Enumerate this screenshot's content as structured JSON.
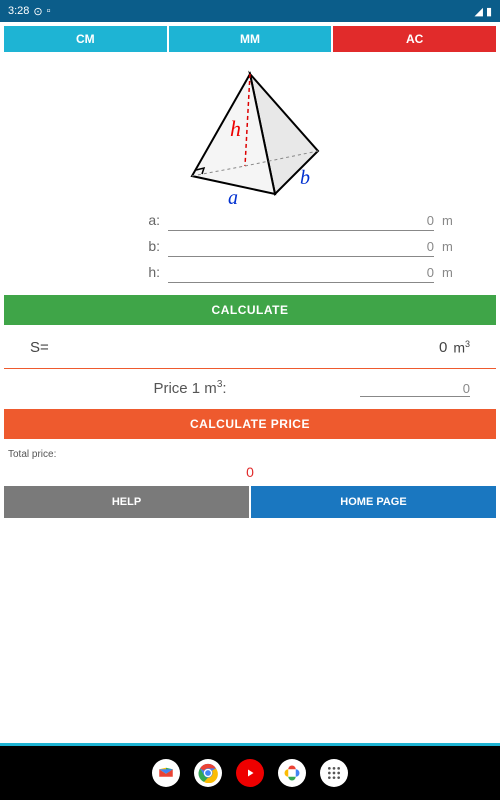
{
  "status": {
    "time": "3:28",
    "signal": "◢",
    "battery": "▮"
  },
  "tabs": {
    "cm": "CM",
    "mm": "MM",
    "ac": "AC"
  },
  "diagram": {
    "label_h": "h",
    "label_a": "a",
    "label_b": "b"
  },
  "inputs": {
    "a": {
      "label": "a:",
      "value": "0",
      "unit": "m"
    },
    "b": {
      "label": "b:",
      "value": "0",
      "unit": "m"
    },
    "h": {
      "label": "h:",
      "value": "0",
      "unit": "m"
    }
  },
  "buttons": {
    "calculate": "CALCULATE",
    "calculate_price": "CALCULATE PRICE",
    "help": "HELP",
    "home": "HOME PAGE"
  },
  "result": {
    "label": "S=",
    "value": "0",
    "unit_base": "m",
    "unit_exp": "3"
  },
  "price": {
    "label_prefix": "Price 1 m",
    "label_exp": "3",
    "label_suffix": ":",
    "value": "0"
  },
  "total": {
    "label": "Total price:",
    "value": "0"
  }
}
